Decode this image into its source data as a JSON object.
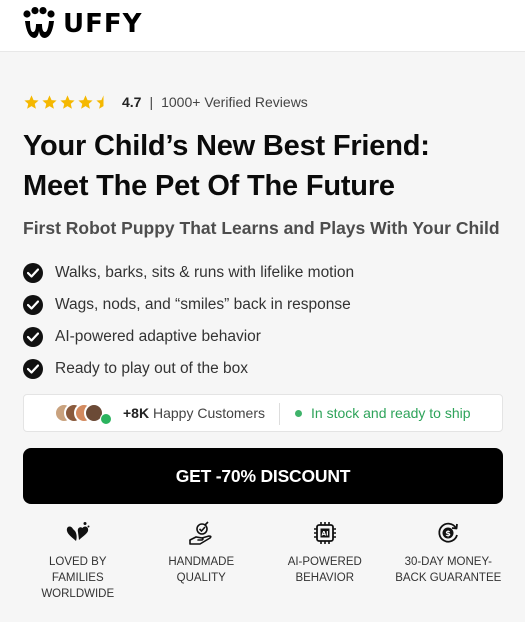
{
  "brand": {
    "name": "UFFY",
    "logo_icon": "paw-w-logo"
  },
  "rating": {
    "stars": 4.5,
    "value": "4.7",
    "separator": "|",
    "reviews_label": "1000+ Verified Reviews",
    "star_color": "#f5b800"
  },
  "hero": {
    "title_line1": "Your Child’s New Best Friend:",
    "title_line2": "Meet The Pet Of The Future",
    "subtitle": "First Robot Puppy That Learns and Plays With Your Child"
  },
  "features": [
    {
      "label": "Walks, barks, sits & runs with lifelike motion",
      "icon": "check-circle-icon"
    },
    {
      "label": "Wags, nods, and “smiles” back in response",
      "icon": "check-circle-icon"
    },
    {
      "label": "AI-powered adaptive behavior",
      "icon": "check-circle-icon"
    },
    {
      "label": "Ready to play out of the box",
      "icon": "check-circle-icon"
    }
  ],
  "social_proof": {
    "count": "+8K",
    "count_label": "Happy Customers",
    "stock_text": "In stock and ready to ship",
    "stock_color": "#2ea35a"
  },
  "cta": {
    "label": "GET -70% DISCOUNT"
  },
  "badges": [
    {
      "icon": "heart-hands-icon",
      "label": "LOVED BY\nFAMILIES\nWORLDWIDE"
    },
    {
      "icon": "handmade-icon",
      "label": "HANDMADE\nQUALITY"
    },
    {
      "icon": "ai-chip-icon",
      "label": "AI-POWERED\nBEHAVIOR"
    },
    {
      "icon": "money-back-icon",
      "label": "30-DAY MONEY-\nBACK GUARANTEE"
    }
  ]
}
